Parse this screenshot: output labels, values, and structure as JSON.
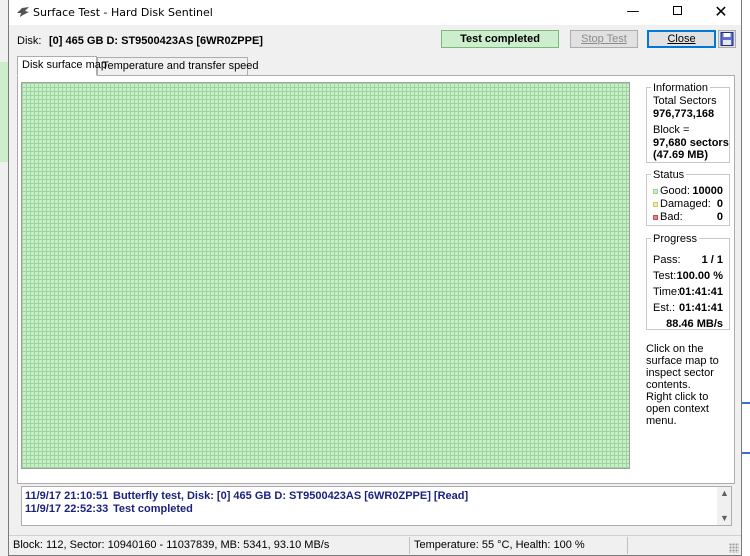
{
  "window": {
    "title": "Surface Test - Hard Disk Sentinel",
    "minimize_glyph": "—",
    "close_glyph": "✕"
  },
  "toolbar": {
    "disk_label": "Disk:",
    "disk_value": "[0] 465 GB D: ST9500423AS [6WR0ZPPE]",
    "status_text": "Test completed",
    "stop_label": "Stop Test",
    "close_label": "Close"
  },
  "tabs": [
    {
      "label": "Disk surface map",
      "active": true
    },
    {
      "label": "Temperature and transfer speed",
      "active": false
    }
  ],
  "information": {
    "title": "Information",
    "total_sectors_label": "Total Sectors",
    "total_sectors_value": "976,773,168",
    "block_label": "Block =",
    "block_sectors": "97,680 sectors",
    "block_size": "(47.69 MB)"
  },
  "status": {
    "title": "Status",
    "good_label": "Good:",
    "good_value": "10000",
    "damaged_label": "Damaged:",
    "damaged_value": "0",
    "bad_label": "Bad:",
    "bad_value": "0",
    "good_color": "#c8f0c8",
    "damaged_color": "#f0f0a0",
    "bad_color": "#f08080"
  },
  "progress": {
    "title": "Progress",
    "pass_label": "Pass:",
    "pass_value": "1 / 1",
    "test_label": "Test:",
    "test_value": "100.00 %",
    "time_label": "Time:",
    "time_value": "01:41:41",
    "est_label": "Est.:",
    "est_value": "01:41:41",
    "speed_value": "88.46 MB/s"
  },
  "hints": {
    "inspect": "Click on the surface map to inspect sector contents.",
    "context": "Right click to open context menu."
  },
  "log": [
    {
      "timestamp": "11/9/17  21:10:51",
      "message": "Butterfly test, Disk: [0] 465 GB D: ST9500423AS [6WR0ZPPE] [Read]"
    },
    {
      "timestamp": "11/9/17  22:52:33",
      "message": "Test completed"
    }
  ],
  "statusbar": {
    "block_info": "Block: 112, Sector: 10940160 - 11037839, MB: 5341, 93.10 MB/s",
    "temperature": "Temperature: 55  °C,  Health: 100 %"
  },
  "colors": {
    "surface_good": "#c8f0c8",
    "log_text": "#1a237e",
    "status_ok": "#cdeecd"
  }
}
